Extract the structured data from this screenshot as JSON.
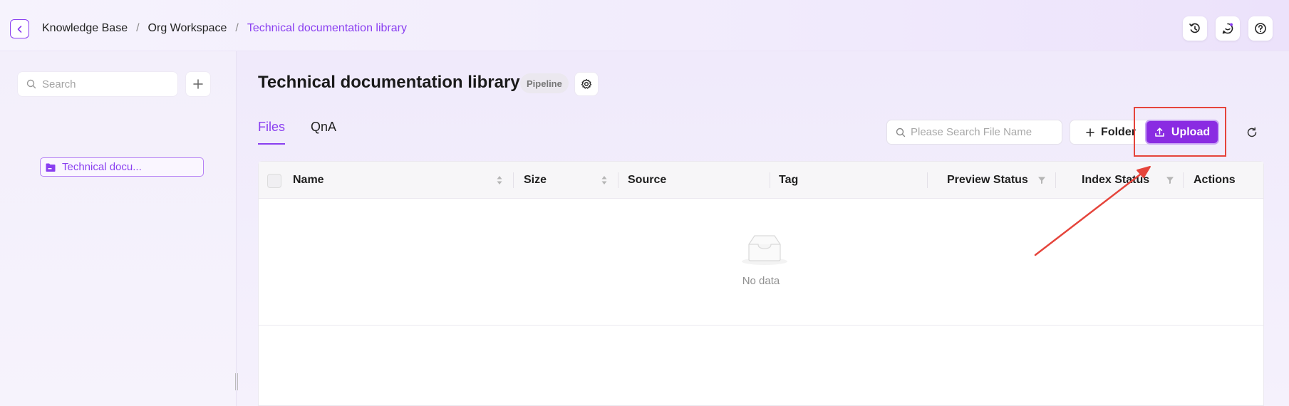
{
  "breadcrumb": {
    "items": [
      "Knowledge Base",
      "Org Workspace",
      "Technical documentation library"
    ],
    "separator": "/"
  },
  "sidebar": {
    "search_placeholder": "Search",
    "tree_items": [
      {
        "label": "Technical docu..."
      }
    ]
  },
  "main": {
    "title": "Technical documentation library",
    "badge": "Pipeline",
    "tabs": [
      {
        "label": "Files",
        "active": true
      },
      {
        "label": "QnA",
        "active": false
      }
    ],
    "file_search_placeholder": "Please Search File Name",
    "folder_label": "Folder",
    "upload_label": "Upload"
  },
  "table": {
    "columns": [
      "Name",
      "Size",
      "Source",
      "Tag",
      "Preview Status",
      "Index Status",
      "Actions"
    ],
    "empty_text": "No data"
  },
  "colors": {
    "accent": "#8a3ff0",
    "upload_bg": "#8a2be2",
    "annotation": "#e5443b"
  }
}
